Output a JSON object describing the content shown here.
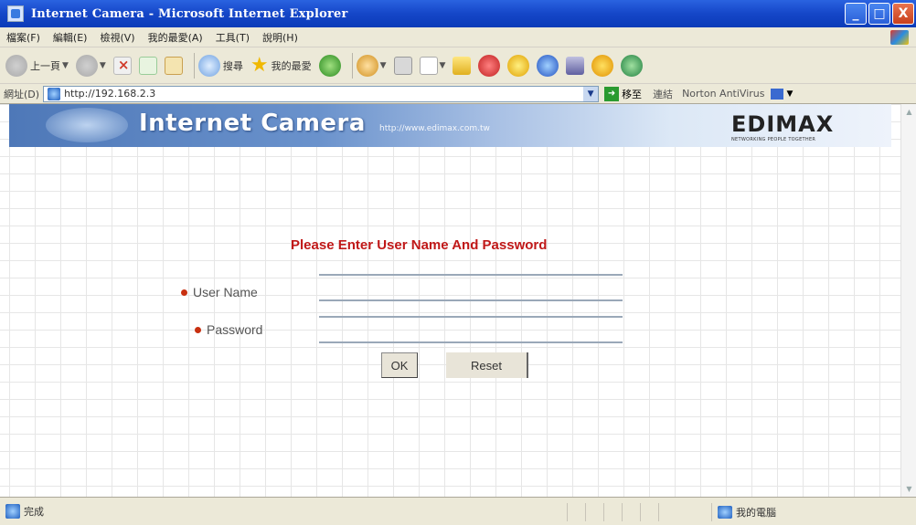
{
  "window": {
    "title": "Internet Camera - Microsoft Internet Explorer",
    "minimize": "_",
    "maximize": "□",
    "close": "X"
  },
  "menu": [
    "檔案(F)",
    "編輯(E)",
    "檢視(V)",
    "我的最愛(A)",
    "工具(T)",
    "說明(H)"
  ],
  "toolbar": {
    "back": "上一頁",
    "search": "搜尋",
    "favorites": "我的最愛"
  },
  "address": {
    "label": "網址(D)",
    "value": "http://192.168.2.3",
    "go": "移至",
    "links": "連結",
    "norton": "Norton AntiVirus"
  },
  "banner": {
    "title": "Internet Camera",
    "url": "http://www.edimax.com.tw",
    "logo": "EDIMAX",
    "tagline": "NETWORKING PEOPLE TOGETHER"
  },
  "form": {
    "heading": "Please Enter User Name And Password",
    "username_label": "User Name",
    "password_label": "Password",
    "username_value": "",
    "password_value": "",
    "ok": "OK",
    "reset": "Reset"
  },
  "status": {
    "text": "完成",
    "zone": "我的電腦"
  }
}
